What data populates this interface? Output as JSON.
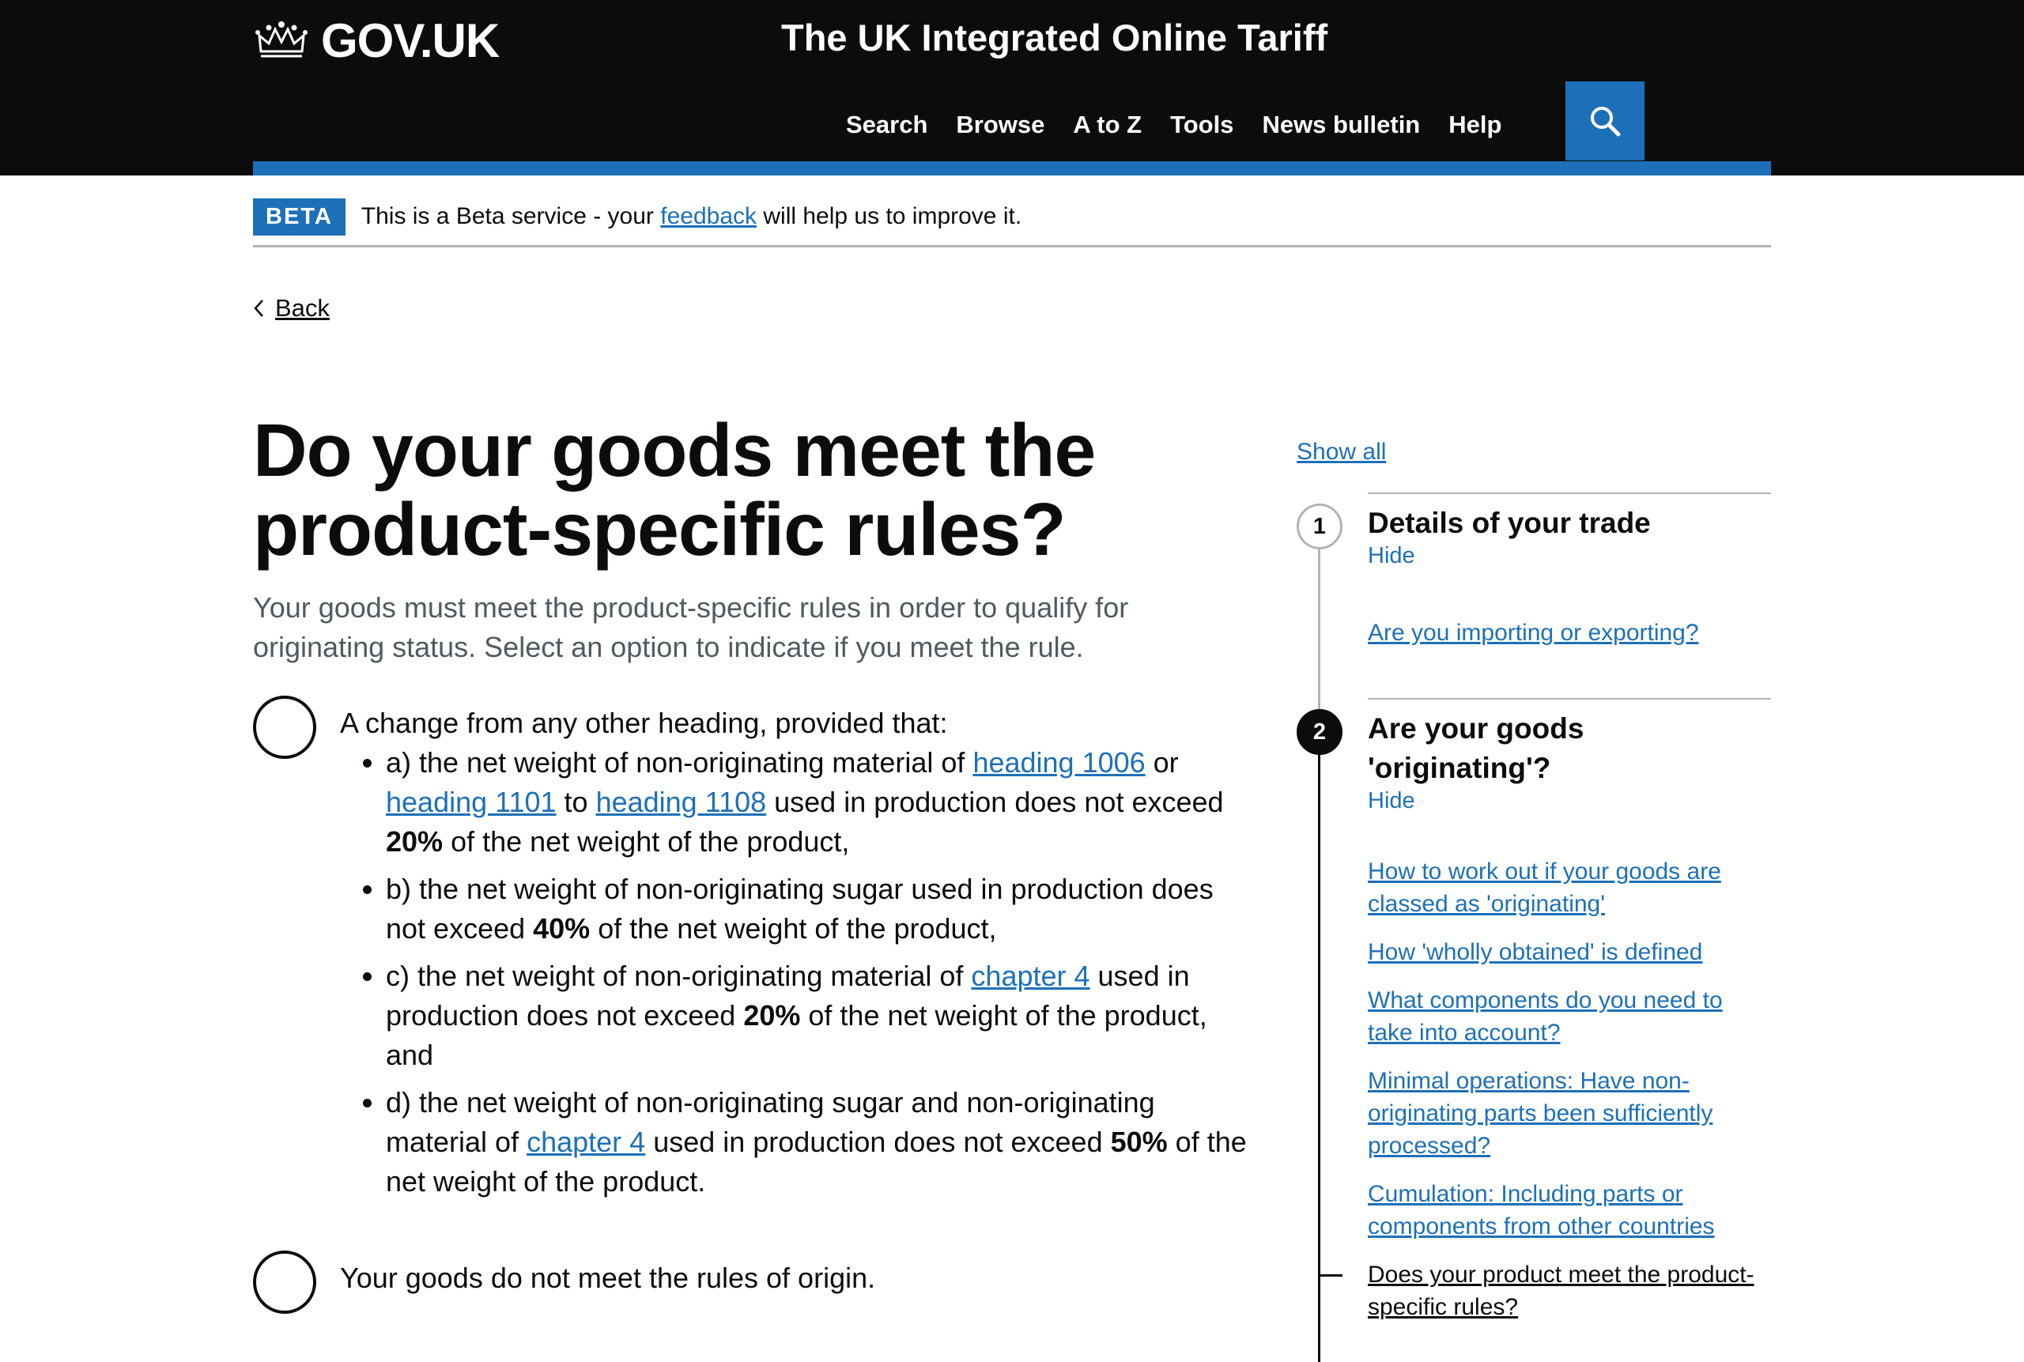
{
  "header": {
    "logo_text": "GOV.UK",
    "service_name": "The UK Integrated Online Tariff",
    "nav": [
      "Search",
      "Browse",
      "A to Z",
      "Tools",
      "News bulletin",
      "Help"
    ],
    "search_icon": "search-icon"
  },
  "beta": {
    "tag": "BETA",
    "text_before": "This is a Beta service - your ",
    "link": "feedback",
    "text_after": " will help us to improve it."
  },
  "back": "Back",
  "main": {
    "title": "Do your goods meet the product-specific rules?",
    "lead": "Your goods must meet the product-specific rules in order to qualify for originating status. Select an option to indicate if you meet the rule.",
    "option1": {
      "intro": "A change from any other heading, provided that:",
      "a": {
        "t1": "a) the net weight of non-originating material of ",
        "link1": "heading 1006",
        "t2": " or ",
        "link2": "heading 1101",
        "t3": " to ",
        "link3": "heading 1108",
        "t4": " used in production does not exceed ",
        "bold": "20%",
        "t5": " of the net weight of the product,"
      },
      "b": {
        "t1": "b) the net weight of non-originating sugar used in production does not exceed ",
        "bold": "40%",
        "t2": " of the net weight of the product,"
      },
      "c": {
        "t1": "c) the net weight of non-originating material of ",
        "link1": "chapter 4",
        "t2": " used in production does not exceed ",
        "bold": "20%",
        "t3": " of the net weight of the product, and"
      },
      "d": {
        "t1": "d) the net weight of non-originating sugar and non-originating material of ",
        "link1": "chapter 4",
        "t2": " used in production does not exceed ",
        "bold": "50%",
        "t3": " of the net weight of the product."
      }
    },
    "option2": "Your goods do not meet the rules of origin."
  },
  "sidebar": {
    "show_all": "Show all",
    "steps": [
      {
        "number": "1",
        "title": "Details of your trade",
        "hide": "Hide",
        "links": [
          "Are you importing or exporting?"
        ]
      },
      {
        "number": "2",
        "title": "Are your goods 'originating'?",
        "hide": "Hide",
        "links": [
          "How to work out if your goods are classed as 'originating'",
          "How 'wholly obtained' is defined",
          "What components do you need to take into account?",
          "Minimal operations: Have non-originating parts been sufficiently processed?",
          "Cumulation: Including parts or components from other countries"
        ],
        "current": "Does your product meet the product-specific rules?"
      }
    ]
  }
}
